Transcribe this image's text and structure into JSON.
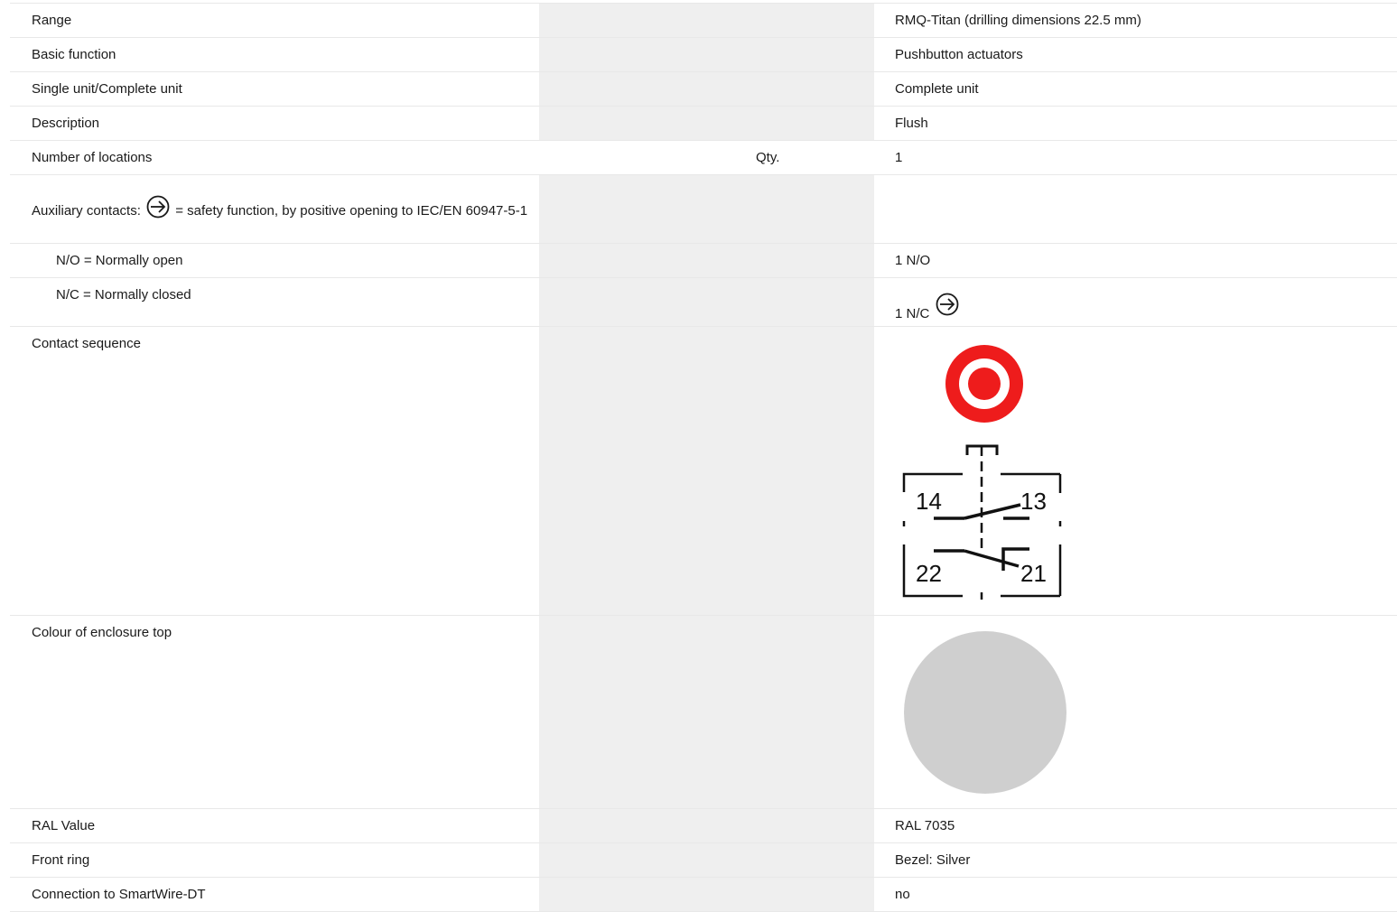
{
  "rows": {
    "range": {
      "label": "Range",
      "value": "RMQ-Titan (drilling dimensions 22.5 mm)"
    },
    "basic_function": {
      "label": "Basic function",
      "value": "Pushbutton actuators"
    },
    "single_complete": {
      "label": "Single unit/Complete unit",
      "value": "Complete unit"
    },
    "description": {
      "label": "Description",
      "value": "Flush"
    },
    "locations": {
      "label": "Number of locations",
      "unit": "Qty.",
      "value": "1"
    },
    "aux_contacts": {
      "label_prefix": "Auxiliary contacts:",
      "label_suffix": "= safety function, by positive opening to IEC/EN 60947-5-1"
    },
    "no": {
      "label": "N/O = Normally open",
      "value": "1 N/O"
    },
    "nc": {
      "label": "N/C = Normally closed",
      "value": "1 N/C"
    },
    "contact_sequence": {
      "label": "Contact sequence",
      "terminals": {
        "t14": "14",
        "t13": "13",
        "t22": "22",
        "t21": "21"
      }
    },
    "enclosure_colour": {
      "label": "Colour of enclosure top"
    },
    "ral": {
      "label": "RAL Value",
      "value": "RAL 7035"
    },
    "front_ring": {
      "label": "Front ring",
      "value": "Bezel: Silver"
    },
    "smartwire": {
      "label": "Connection to SmartWire-DT",
      "value": "no"
    }
  },
  "icons": {
    "safety": "positive-opening-arrow-icon",
    "actuator": "red-pushbutton-icon",
    "swatch": "grey-colour-swatch"
  },
  "colors": {
    "actuator_red": "#ee1c1c",
    "swatch_grey": "#cfcfcf",
    "shade": "#efefef"
  }
}
